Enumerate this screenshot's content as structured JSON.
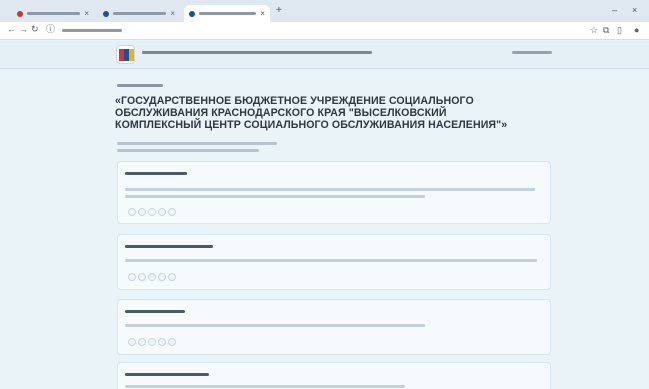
{
  "browser": {
    "tabs": [
      {
        "title": "",
        "favicon_color": "#c0392b",
        "active": false
      },
      {
        "title": "",
        "favicon_color": "#1f4f96",
        "active": false
      },
      {
        "title": "",
        "favicon_color": "#1f4f96",
        "active": true
      }
    ],
    "new_tab_icon": "plus-icon",
    "window_controls": [
      "minimize-icon",
      "close-icon"
    ],
    "address": "",
    "toolbar_icons": [
      "bookmark-icon",
      "extensions-icon",
      "sidebar-icon",
      "profile-icon"
    ]
  },
  "header": {
    "site_title": "",
    "search_placeholder": ""
  },
  "main": {
    "subtitle": "",
    "org_name": "«ГОСУДАРСТВЕННОЕ БЮДЖЕТНОЕ УЧРЕЖДЕНИЕ СОЦИАЛЬНОГО ОБСЛУЖИВАНИЯ КРАСНОДАРСКОГО КРАЯ \"ВЫСЕЛКОВСКИЙ КОМПЛЕКСНЫЙ ЦЕНТР СОЦИАЛЬНОГО ОБСЛУЖИВАНИЯ НАСЕЛЕНИЯ\"»",
    "notes": [
      "",
      ""
    ],
    "cards": [
      {
        "title": "",
        "description": "",
        "rating_max": 5
      },
      {
        "title": "",
        "description": "",
        "rating_max": 5
      },
      {
        "title": "",
        "description": "",
        "rating_max": 5
      },
      {
        "title": "",
        "description": ""
      }
    ]
  },
  "colors": {
    "page_bg": "#e9f3f8",
    "card_bg": "#f5fafd",
    "text": "#2f3740",
    "accent": "#1f4f96"
  }
}
